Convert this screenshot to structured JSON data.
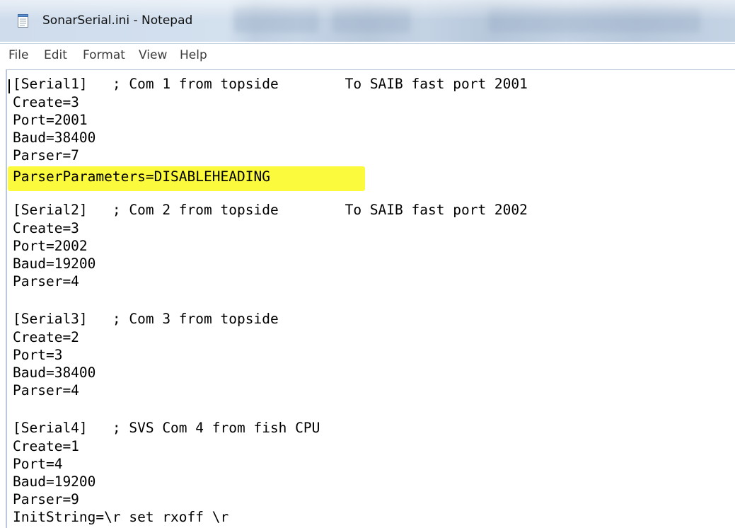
{
  "window": {
    "title": "SonarSerial.ini - Notepad",
    "app_icon": "notepad-icon"
  },
  "menu": [
    "File",
    "Edit",
    "Format",
    "View",
    "Help"
  ],
  "colors": {
    "highlight": "#fbfa3d",
    "text": "#000000"
  },
  "content": {
    "lines": [
      "[Serial1]   ; Com 1 from topside        To SAIB fast port 2001",
      "Create=3",
      "Port=2001",
      "Baud=38400",
      "Parser=7",
      "ParserParameters=DISABLEHEADING",
      "[Serial2]   ; Com 2 from topside        To SAIB fast port 2002",
      "Create=3",
      "Port=2002",
      "Baud=19200",
      "Parser=4",
      "[Serial3]   ; Com 3 from topside",
      "Create=2",
      "Port=3",
      "Baud=38400",
      "Parser=4",
      "[Serial4]   ; SVS Com 4 from fish CPU",
      "Create=1",
      "Port=4",
      "Baud=19200",
      "Parser=9",
      "InitString=\\r set rxoff \\r"
    ]
  }
}
